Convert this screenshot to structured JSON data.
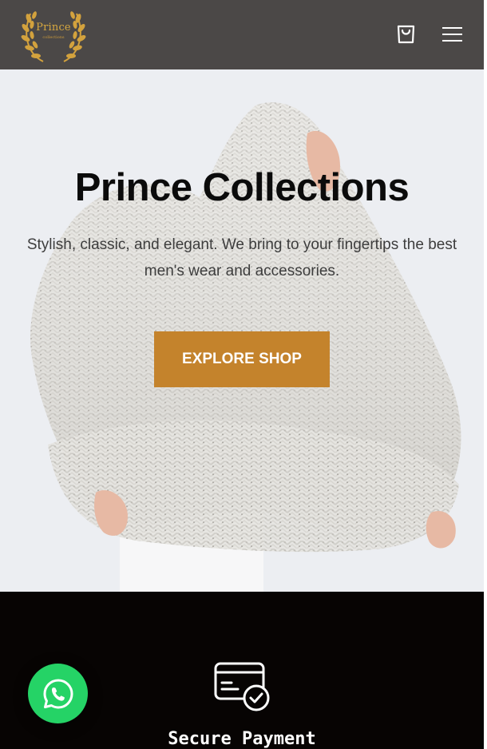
{
  "header": {
    "logo": {
      "title": "Prince",
      "subtitle": "collections"
    },
    "cart_icon": "shopping-bag-icon",
    "menu_icon": "hamburger-menu-icon",
    "background": "#4b4847"
  },
  "hero": {
    "title": "Prince Collections",
    "subtitle": "Stylish, classic, and elegant. We bring to your fingertips the best men's wear and accessories.",
    "cta_label": "EXPLORE SHOP",
    "cta_color": "#c4832c"
  },
  "features": {
    "icon": "credit-card-check-icon",
    "title": "Secure Payment",
    "background": "#070403"
  },
  "whatsapp": {
    "icon": "whatsapp-icon",
    "color": "#25d366"
  }
}
